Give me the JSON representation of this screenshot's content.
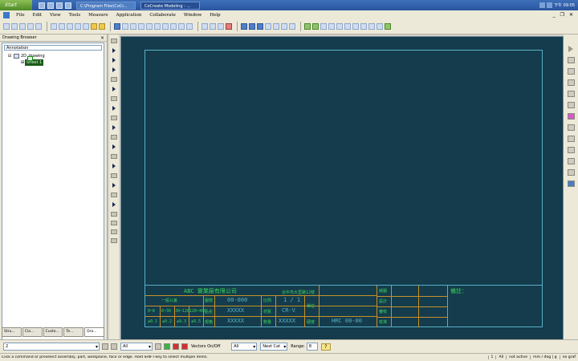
{
  "taskbar": {
    "start_label": "Xtart",
    "tasks": [
      "C:\\Program Files\\CoCr...",
      "CoCreate Modeling - ..."
    ],
    "clock": "下午 09:05"
  },
  "menubar": {
    "items": [
      "File",
      "Edit",
      "View",
      "Tools",
      "Measure",
      "Application",
      "Collaborate",
      "Window",
      "Help"
    ]
  },
  "browser": {
    "title": "Drawing Browser",
    "filter_value": "Annotation",
    "tree": [
      {
        "label": "2D_drawing",
        "level": 0
      },
      {
        "label": "Sheet 1",
        "level": 1
      }
    ],
    "tabs": [
      "Stru...",
      "Cla...",
      "Custo...",
      "Te...",
      "Dra..."
    ]
  },
  "titleblock": {
    "company": "ABC 實業廠有限公司",
    "address": "台中市大里路12號",
    "date_label": "一般公差",
    "tol_headers": [
      "0~6",
      "6~30",
      "30~120",
      "120~400"
    ],
    "tol_values": [
      "±0.1",
      "±0.2",
      "±0.3",
      "±0.5"
    ],
    "row_labels": [
      "圖號",
      "品名",
      "規格"
    ],
    "row_values": [
      "00-000",
      "XXXXX",
      "XXXXX"
    ],
    "right_labels": [
      "比例",
      "材質",
      "數量"
    ],
    "right_values": [
      "1 / 1",
      "CR-V",
      "XXXXX"
    ],
    "extra_labels": [
      "單位",
      "硬度"
    ],
    "hardness": "HRC 00-00",
    "sign_labels": [
      "繪圖",
      "設計",
      "審核",
      "核准"
    ],
    "remark": "備註："
  },
  "statusline": {
    "input_value": "2",
    "select_all": "All",
    "vectors_label": "Vectors On/Off",
    "filter_all": "All",
    "next_cat": "Next Cat",
    "range_label": "Range:",
    "range_value": "8",
    "help": "?"
  },
  "msgbar": {
    "message": "Click a command or preselect assembly, part, workplane, face or edge. Hold SHIFT-key to select multiple items.",
    "fields": [
      "1",
      "All",
      "not active",
      "mm / deg | g",
      "no graf"
    ]
  }
}
